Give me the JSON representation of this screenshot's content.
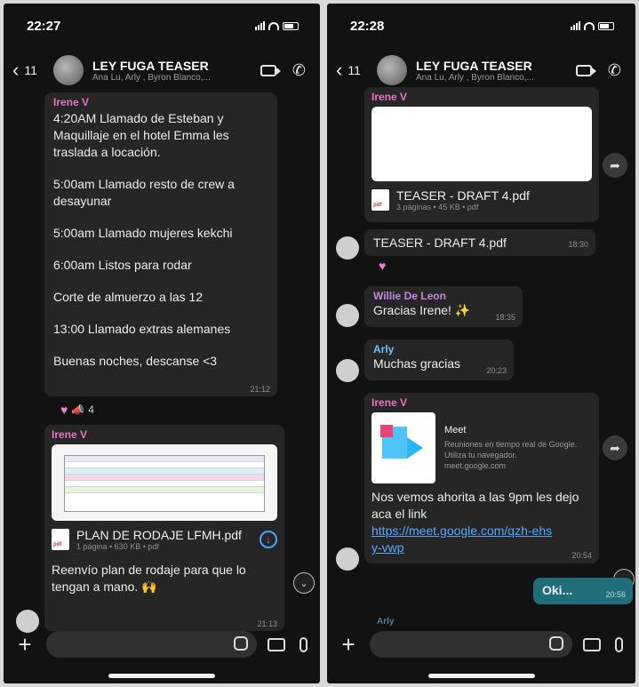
{
  "left": {
    "status": {
      "time": "22:27"
    },
    "header": {
      "back_count": "11",
      "title": "LEY FUGA TEASER",
      "subtitle": "Ana Lu, Arly , Byron Blanco,..."
    },
    "msg1": {
      "sender": "Irene V",
      "lines": [
        "4:20AM Llamado de Esteban y Maquillaje en el hotel Emma les traslada a locación.",
        "5:00am Llamado resto de crew a desayunar",
        "5:00am Llamado mujeres kekchi",
        "6:00am Listos para rodar",
        "Corte de almuerzo a las 12",
        "13:00 Llamado extras alemanes",
        "Buenas noches, descanse <3"
      ],
      "time": "21:12",
      "reaction_count": "4"
    },
    "msg2": {
      "sender": "Irene V",
      "file_name": "PLAN DE RODAJE LFMH.pdf",
      "file_meta": "1 página • 630 KB • pdf",
      "caption": "Reenvío plan de rodaje para que lo tengan a mano. 🙌",
      "time": "21:13"
    }
  },
  "right": {
    "status": {
      "time": "22:28"
    },
    "header": {
      "back_count": "11",
      "title": "LEY FUGA TEASER",
      "subtitle": "Ana Lu, Arly , Byron Blanco,..."
    },
    "msg1": {
      "sender": "Irene V",
      "file_name": "TEASER - DRAFT 4.pdf",
      "file_meta": "3 páginas • 45 KB • pdf"
    },
    "msg2": {
      "text": "TEASER - DRAFT 4.pdf",
      "time": "18:30"
    },
    "msg3": {
      "sender": "Willie De Leon",
      "text": "Gracias Irene! ✨",
      "time": "18:35"
    },
    "msg4": {
      "sender": "Arly",
      "text": "Muchas gracias",
      "time": "20:23"
    },
    "msg5": {
      "sender": "Irene V",
      "preview_title": "Meet",
      "preview_desc": "Reuniones en tiempo real de Google. Utiliza tu navegador.",
      "preview_domain": "meet.google.com",
      "text": "Nos vemos ahorita a las 9pm les dejo aca el link",
      "link": "https://meet.google.com/qzh-ehsy-vwp",
      "time": "20:54"
    },
    "msg6": {
      "text": "Oki...",
      "time": "20:56"
    },
    "partial_sender": "Arly"
  },
  "icons": [
    "back-chevron-icon",
    "group-avatar",
    "video-call-icon",
    "phone-call-icon",
    "pdf-icon",
    "download-icon",
    "heart-icon",
    "megaphone-icon",
    "forward-icon",
    "scroll-down-icon",
    "plus-icon",
    "sticker-icon",
    "camera-icon",
    "mic-icon"
  ],
  "colors": {
    "background": "#121212",
    "bubble": "#262626",
    "sender_pink": "#e573c8",
    "link": "#56a8ff",
    "outgoing": "#1f6f7a"
  }
}
